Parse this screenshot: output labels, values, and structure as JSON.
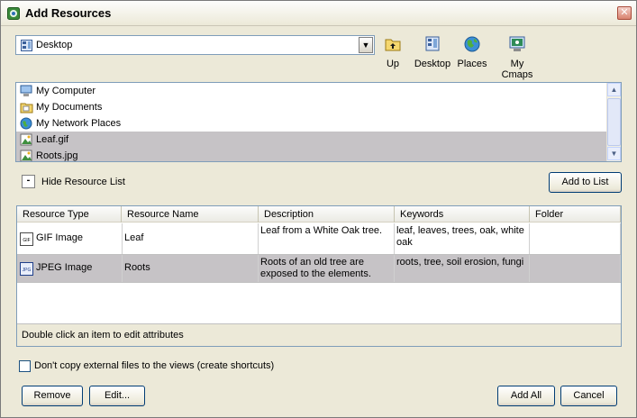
{
  "window": {
    "title": "Add Resources",
    "close_symbol": "✕"
  },
  "location": {
    "value": "Desktop",
    "dropdown_symbol": "▼"
  },
  "nav_buttons": [
    {
      "label": "Up",
      "icon": "up-folder-icon"
    },
    {
      "label": "Desktop",
      "icon": "desktop-icon"
    },
    {
      "label": "Places",
      "icon": "places-globe-icon"
    },
    {
      "label": "My Cmaps",
      "icon": "my-cmaps-icon"
    }
  ],
  "file_list": {
    "items": [
      {
        "name": "My Computer",
        "icon": "computer-icon",
        "selected": false
      },
      {
        "name": "My Documents",
        "icon": "documents-folder-icon",
        "selected": false
      },
      {
        "name": "My Network Places",
        "icon": "network-places-icon",
        "selected": false
      },
      {
        "name": "Leaf.gif",
        "icon": "image-file-icon",
        "selected": true
      },
      {
        "name": "Roots.jpg",
        "icon": "image-file-icon",
        "selected": true
      }
    ]
  },
  "resource_toggle": {
    "symbol": "-",
    "label": "Hide Resource List"
  },
  "add_to_list_label": "Add to List",
  "table": {
    "columns": [
      "Resource Type",
      "Resource Name",
      "Description",
      "Keywords",
      "Folder"
    ],
    "rows": [
      {
        "type": "GIF Image",
        "type_badge": "GIF",
        "name": "Leaf",
        "description": "Leaf from a White Oak tree.",
        "keywords": "leaf, leaves, trees, oak, white oak",
        "folder": "",
        "selected": false
      },
      {
        "type": "JPEG Image",
        "type_badge": "JPG",
        "name": "Roots",
        "description": "Roots of an old tree are exposed to the elements.",
        "keywords": "roots, tree, soil erosion, fungi",
        "folder": "",
        "selected": true
      }
    ],
    "status": "Double click an item to edit attributes"
  },
  "no_copy_option": {
    "label": "Don't copy external files to the views (create shortcuts)",
    "checked": false
  },
  "buttons": {
    "remove": "Remove",
    "edit": "Edit...",
    "add_all": "Add All",
    "cancel": "Cancel"
  },
  "colors": {
    "selection": "#c6c3c6",
    "dialog_bg": "#ece9d8",
    "button_border": "#003c74"
  }
}
